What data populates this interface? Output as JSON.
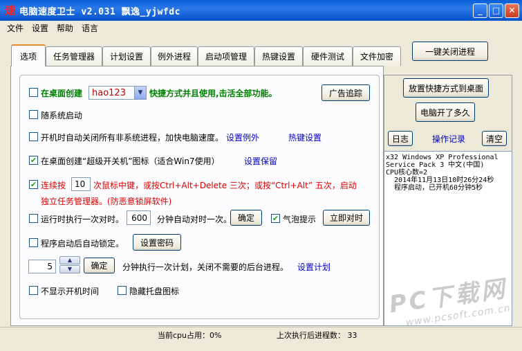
{
  "window": {
    "title": "电脑速度卫士 v2.031 飘逸_yjwfdc",
    "app_icon": "速",
    "buttons": {
      "minimize": "_",
      "maximize": "□",
      "close": "✕"
    }
  },
  "menu": [
    "文件",
    "设置",
    "帮助",
    "语言"
  ],
  "tabs": [
    "选项",
    "任务管理器",
    "计划设置",
    "例外进程",
    "启动项管理",
    "热键设置",
    "硬件测试",
    "文件加密"
  ],
  "top_button": "一键关闭进程",
  "options": {
    "desktop_create_prefix": "在桌面创建",
    "desktop_create_select": "hao123",
    "desktop_create_suffix": "快捷方式并且使用,击活全部功能。",
    "ad_button": "广告追踪",
    "autostart": "随系统启动",
    "kill_nonsys": "开机时自动关闭所有非系统进程，加快电脑速度。",
    "set_exceptions": "设置例外",
    "hotkey_settings": "热键设置",
    "super_shutdown": "在桌面创建“超级开关机”图标（适合Win7使用）",
    "set_keep": "设置保留",
    "mouse_prefix": "连续按",
    "mouse_count": "10",
    "mouse_suffix": "次鼠标中键，或按Ctrl+Alt+Delete 三次；或按“Ctrl+Alt” 五次，启动",
    "mouse_line2": "独立任务管理器。(防恶意锁屏软件)",
    "sync_prefix": "运行时执行一次对时。",
    "sync_minutes": "600",
    "sync_suffix": "分钟自动对时一次。",
    "confirm": "确定",
    "bubble_tip": "气泡提示",
    "sync_now": "立即对时",
    "autolock": "程序启动后自动锁定。",
    "set_password": "设置密码",
    "plan_value": "5",
    "plan_confirm": "确定",
    "plan_text": "分钟执行一次计划，关闭不需要的后台进程。",
    "set_plan": "设置计划",
    "hide_boot_time": "不显示开机时间",
    "hide_tray": "隐藏托盘图标"
  },
  "right": {
    "shortcut_button": "放置快捷方式到桌面",
    "uptime_button": "电脑开了多久",
    "log_button": "日志",
    "op_record": "操作记录",
    "clear_button": "清空",
    "log_lines": [
      "x32 Windows XP Professional",
      "Service Pack 3 中文(中国)",
      "CPU核心数=2",
      "  2014年11月13日10时26分24秒",
      "  程序启动，已开机60分钟5秒"
    ]
  },
  "status": {
    "cpu": "当前cpu占用：0%",
    "last_proc": "上次执行后进程数： 33"
  },
  "watermark": {
    "main": "PC下载网",
    "sub": "www.pcsoft.com.cn"
  },
  "colors": {
    "title_bar": "#0a5fd8",
    "green_text": "#008000",
    "red_text": "#e00000",
    "link": "#0000c8",
    "active_tab": "#e68b2c"
  }
}
